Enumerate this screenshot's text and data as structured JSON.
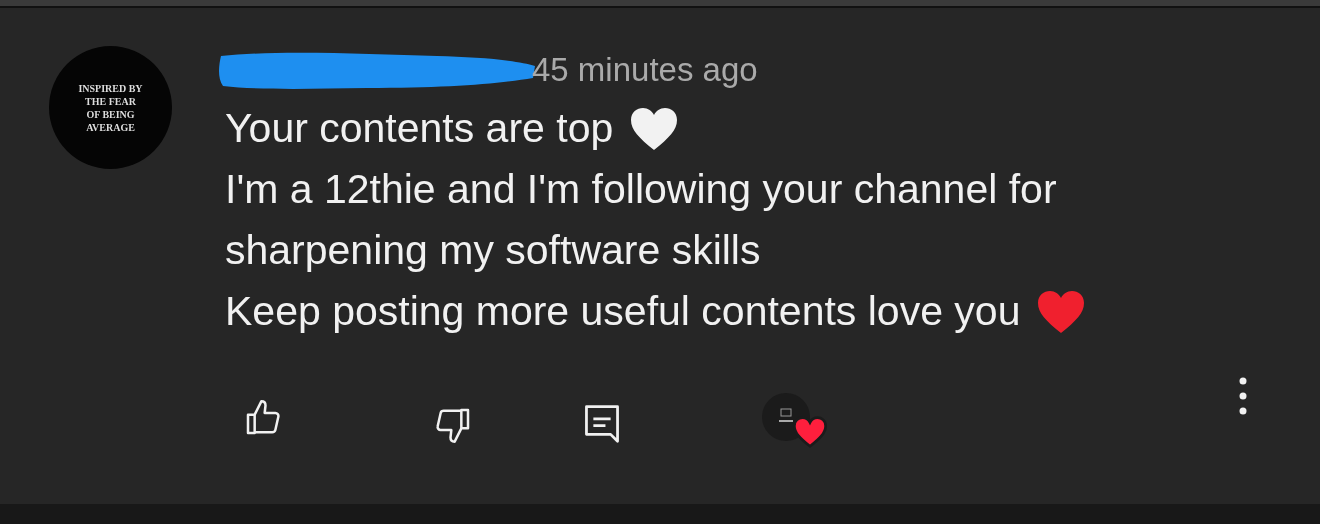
{
  "comment": {
    "avatar_text": [
      "INSPIRED BY",
      "THE FEAR",
      "OF BEING",
      "AVERAGE"
    ],
    "author_redacted": true,
    "time": "45 minutes ago",
    "lines": [
      {
        "text": "Your contents are top",
        "color": "#f2f2f2"
      },
      {
        "text": "I'm a 12thie and I'm following your channel for"
      },
      {
        "text": "sharpening my software skills"
      },
      {
        "text": "Keep posting more useful contents love you",
        "color": "#f0202e"
      }
    ],
    "creator_heart": true
  }
}
